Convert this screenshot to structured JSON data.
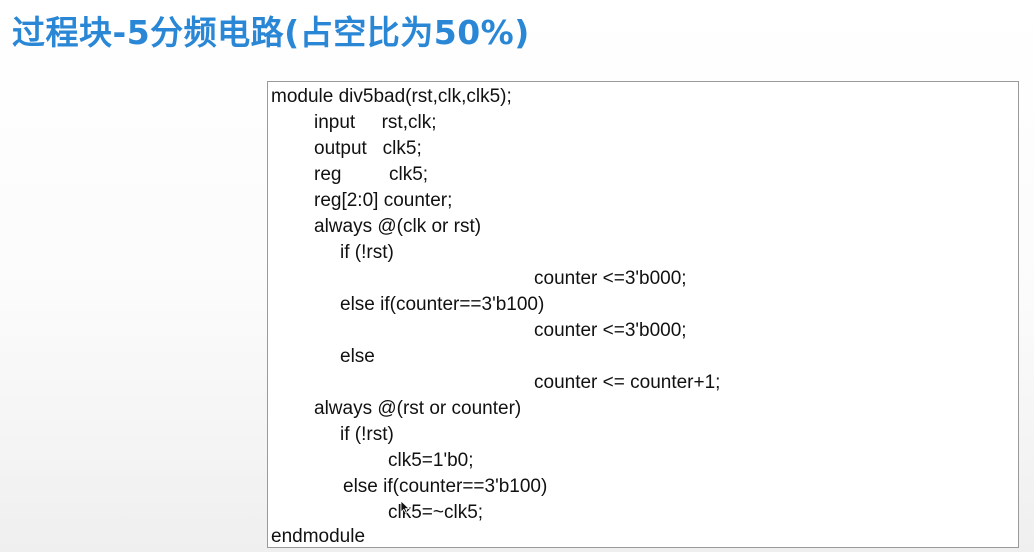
{
  "slide": {
    "title": "过程块-5分频电路(占空比为50%)"
  },
  "code": {
    "lines": [
      "module div5bad(rst,clk,clk5);",
      "input     rst,clk;",
      "output   clk5;",
      "reg         clk5;",
      "reg[2:0] counter;",
      "always @(clk or rst)",
      "if (!rst)",
      "counter <=3'b000;",
      "else if(counter==3'b100)",
      "counter <=3'b000;",
      "else",
      "counter <= counter+1;",
      "always @(rst or counter)",
      "if (!rst)",
      "clk5=1'b0;",
      "else if(counter==3'b100)",
      "clk5=~clk5;",
      "endmodule"
    ]
  },
  "cursor": {
    "icon": "mouse-pointer-icon"
  }
}
